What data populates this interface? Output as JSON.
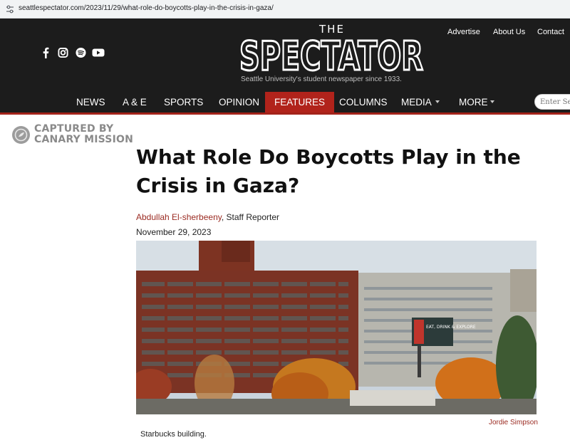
{
  "browser": {
    "url": "seattlespectator.com/2023/11/29/what-role-do-boycotts-play-in-the-crisis-in-gaza/"
  },
  "header": {
    "social": [
      "facebook-icon",
      "instagram-icon",
      "spotify-icon",
      "youtube-icon"
    ],
    "top_links": [
      "Advertise",
      "About Us",
      "Contact"
    ],
    "logo_small": "THE",
    "logo_main": "SPECTATOR",
    "tagline": "Seattle University's student newspaper since 1933."
  },
  "nav": {
    "items": [
      "NEWS",
      "A & E",
      "SPORTS",
      "OPINION",
      "FEATURES",
      "COLUMNS",
      "MEDIA",
      "MORE"
    ],
    "active": "FEATURES",
    "search_placeholder": "Enter Search"
  },
  "badge": {
    "line1": "CAPTURED BY",
    "line2": "CANARY MISSION"
  },
  "article": {
    "title_line1": "What Role Do Boycotts Play in the",
    "title_line2": "Crisis in Gaza?",
    "author": "Abdullah El-sherbeeny",
    "role": ", Staff Reporter",
    "date": "November 29, 2023",
    "photo_credit": "Jordie Simpson",
    "caption": "Starbucks building.",
    "billboard": "EAT, DRINK & EXPLORE"
  },
  "colors": {
    "header_bg": "#1c1c1c",
    "accent_red": "#b1231b",
    "author_red": "#9b2b22"
  }
}
